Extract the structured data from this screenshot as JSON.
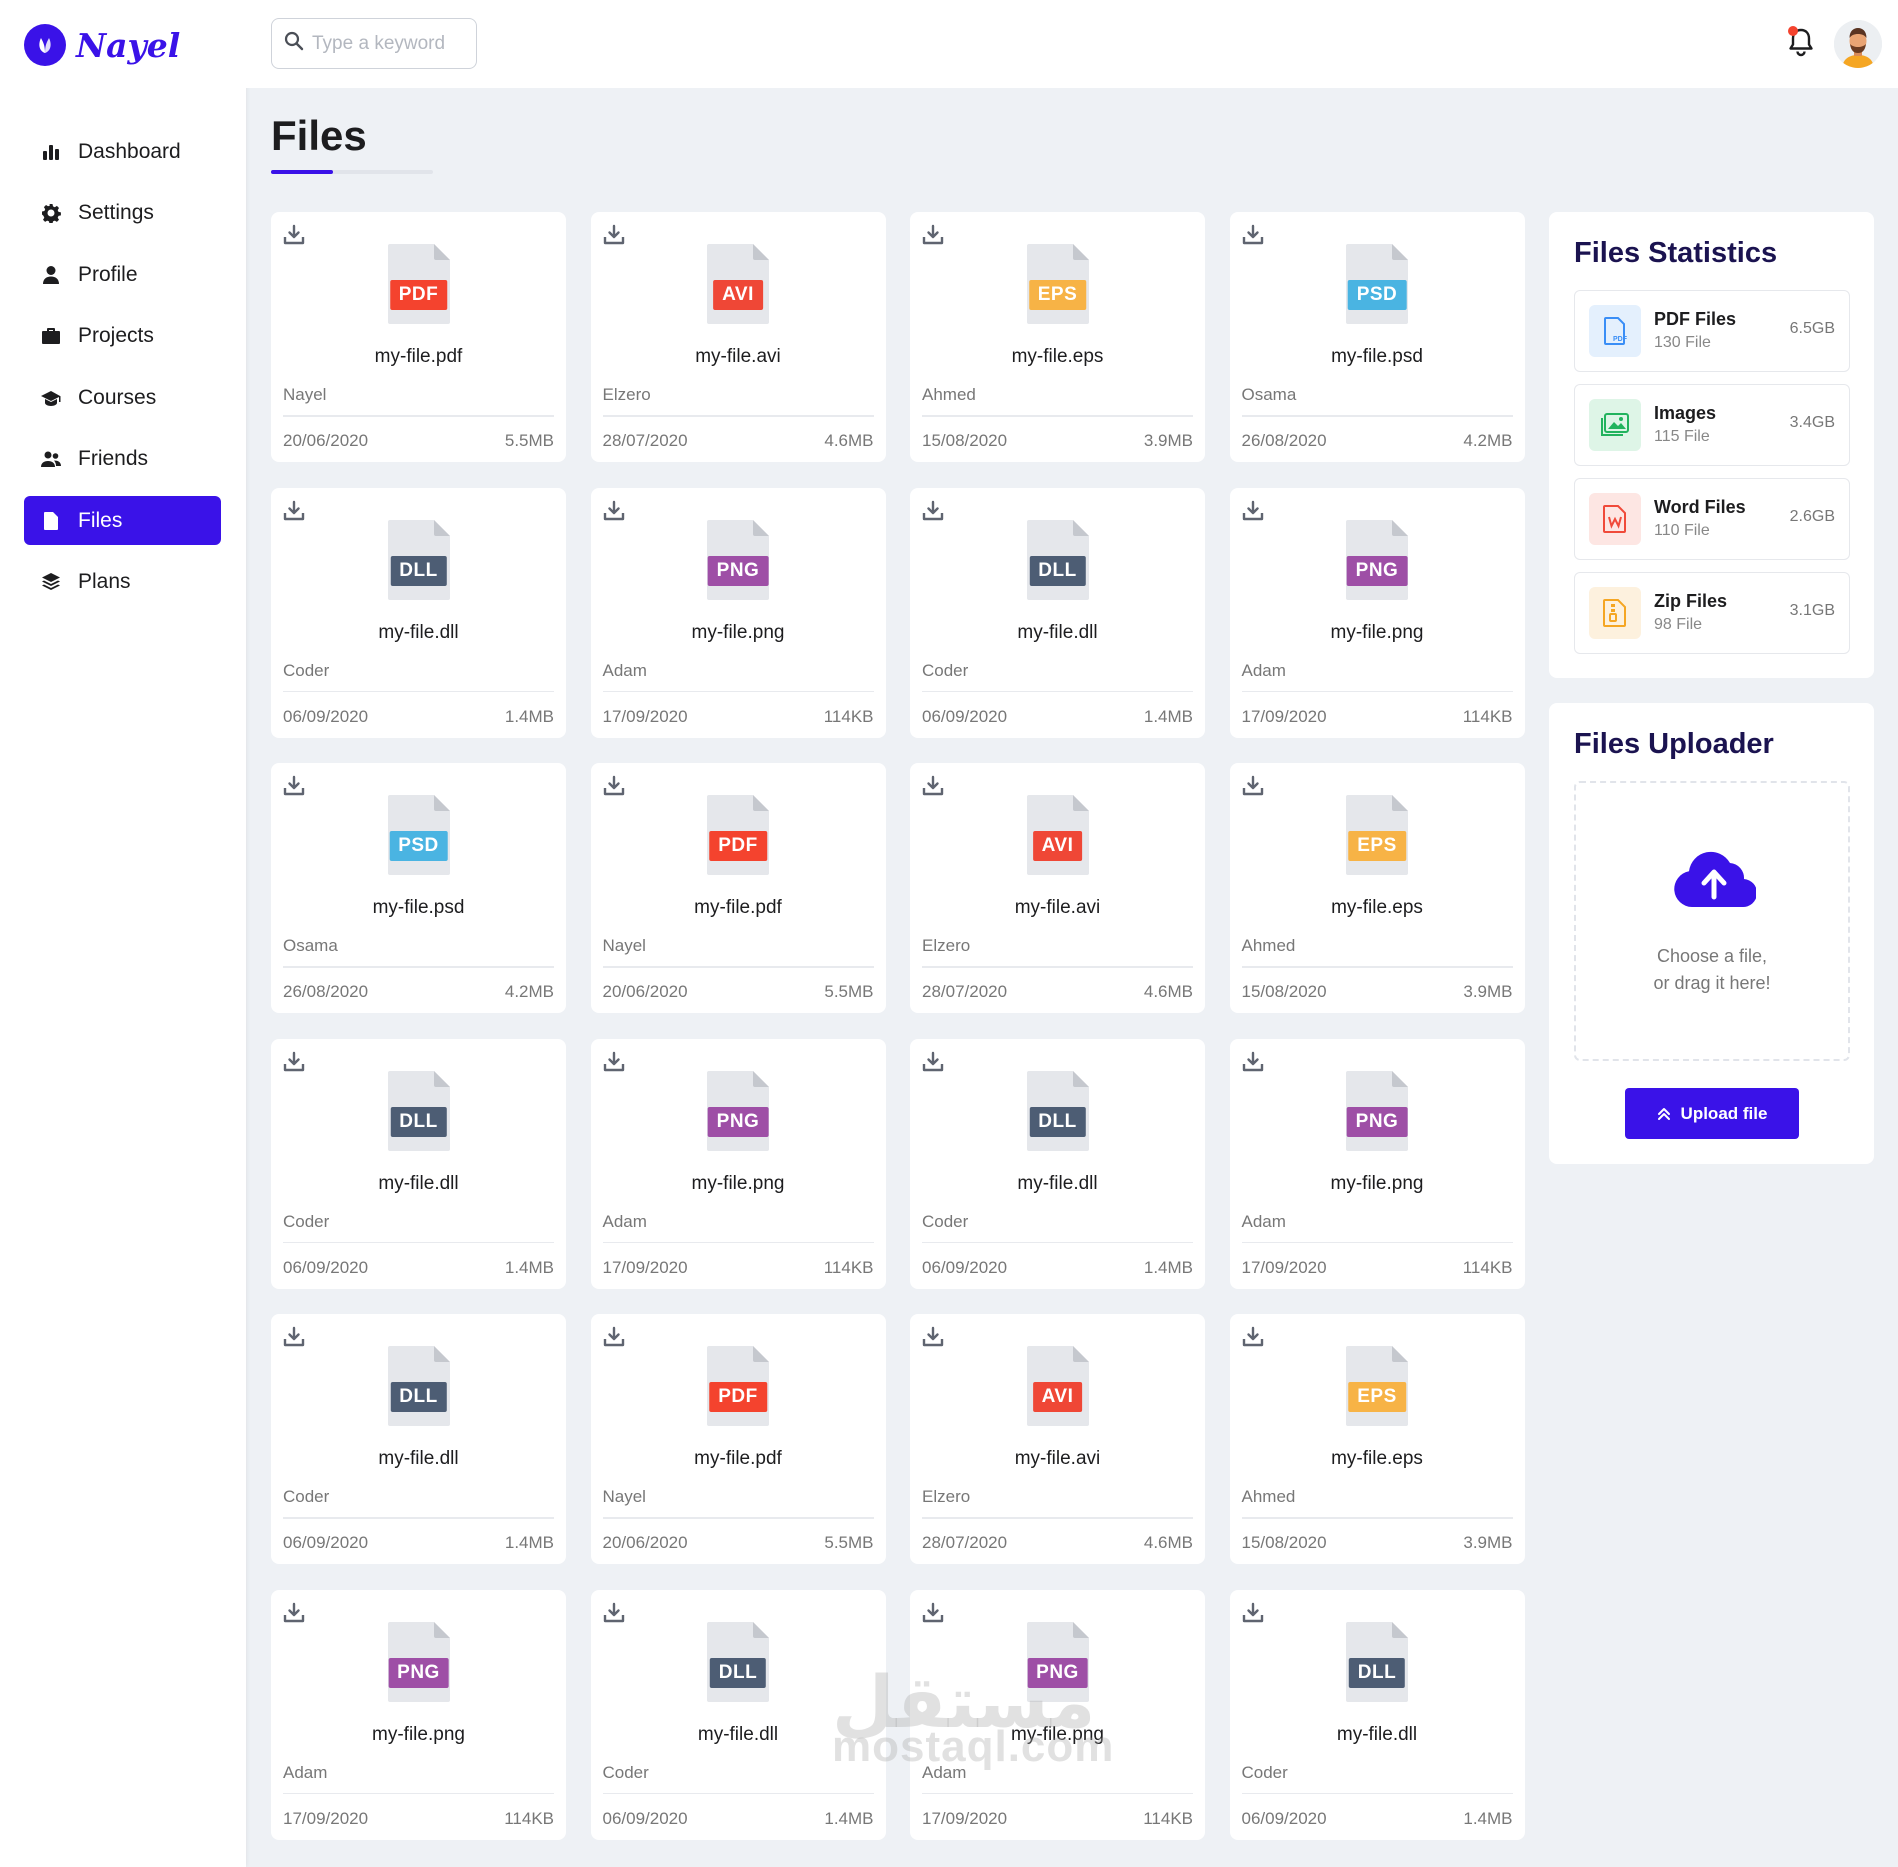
{
  "brand": {
    "name": "Nayel",
    "accent": "#3a12e8"
  },
  "nav": {
    "items": [
      {
        "label": "Dashboard",
        "icon": "bar-chart-icon",
        "active": false
      },
      {
        "label": "Settings",
        "icon": "gear-icon",
        "active": false
      },
      {
        "label": "Profile",
        "icon": "user-icon",
        "active": false
      },
      {
        "label": "Projects",
        "icon": "briefcase-icon",
        "active": false
      },
      {
        "label": "Courses",
        "icon": "graduation-cap-icon",
        "active": false
      },
      {
        "label": "Friends",
        "icon": "users-icon",
        "active": false
      },
      {
        "label": "Files",
        "icon": "file-icon",
        "active": true
      },
      {
        "label": "Plans",
        "icon": "layers-icon",
        "active": false
      }
    ]
  },
  "search": {
    "placeholder": "Type a keyword",
    "value": ""
  },
  "header": {
    "notification_dot_color": "#f4432e"
  },
  "page": {
    "title": "Files"
  },
  "type_colors": {
    "PDF": "#f4432e",
    "AVI": "#ef4736",
    "EPS": "#f7b346",
    "PSD": "#4ab4e2",
    "DLL": "#4d5d74",
    "PNG": "#9e4fa6"
  },
  "files": [
    {
      "type": "PDF",
      "name": "my-file.pdf",
      "owner": "Nayel",
      "date": "20/06/2020",
      "size": "5.5MB"
    },
    {
      "type": "AVI",
      "name": "my-file.avi",
      "owner": "Elzero",
      "date": "28/07/2020",
      "size": "4.6MB"
    },
    {
      "type": "EPS",
      "name": "my-file.eps",
      "owner": "Ahmed",
      "date": "15/08/2020",
      "size": "3.9MB"
    },
    {
      "type": "PSD",
      "name": "my-file.psd",
      "owner": "Osama",
      "date": "26/08/2020",
      "size": "4.2MB"
    },
    {
      "type": "DLL",
      "name": "my-file.dll",
      "owner": "Coder",
      "date": "06/09/2020",
      "size": "1.4MB"
    },
    {
      "type": "PNG",
      "name": "my-file.png",
      "owner": "Adam",
      "date": "17/09/2020",
      "size": "114KB"
    },
    {
      "type": "DLL",
      "name": "my-file.dll",
      "owner": "Coder",
      "date": "06/09/2020",
      "size": "1.4MB"
    },
    {
      "type": "PNG",
      "name": "my-file.png",
      "owner": "Adam",
      "date": "17/09/2020",
      "size": "114KB"
    },
    {
      "type": "PSD",
      "name": "my-file.psd",
      "owner": "Osama",
      "date": "26/08/2020",
      "size": "4.2MB"
    },
    {
      "type": "PDF",
      "name": "my-file.pdf",
      "owner": "Nayel",
      "date": "20/06/2020",
      "size": "5.5MB"
    },
    {
      "type": "AVI",
      "name": "my-file.avi",
      "owner": "Elzero",
      "date": "28/07/2020",
      "size": "4.6MB"
    },
    {
      "type": "EPS",
      "name": "my-file.eps",
      "owner": "Ahmed",
      "date": "15/08/2020",
      "size": "3.9MB"
    },
    {
      "type": "DLL",
      "name": "my-file.dll",
      "owner": "Coder",
      "date": "06/09/2020",
      "size": "1.4MB"
    },
    {
      "type": "PNG",
      "name": "my-file.png",
      "owner": "Adam",
      "date": "17/09/2020",
      "size": "114KB"
    },
    {
      "type": "DLL",
      "name": "my-file.dll",
      "owner": "Coder",
      "date": "06/09/2020",
      "size": "1.4MB"
    },
    {
      "type": "PNG",
      "name": "my-file.png",
      "owner": "Adam",
      "date": "17/09/2020",
      "size": "114KB"
    },
    {
      "type": "DLL",
      "name": "my-file.dll",
      "owner": "Coder",
      "date": "06/09/2020",
      "size": "1.4MB"
    },
    {
      "type": "PDF",
      "name": "my-file.pdf",
      "owner": "Nayel",
      "date": "20/06/2020",
      "size": "5.5MB"
    },
    {
      "type": "AVI",
      "name": "my-file.avi",
      "owner": "Elzero",
      "date": "28/07/2020",
      "size": "4.6MB"
    },
    {
      "type": "EPS",
      "name": "my-file.eps",
      "owner": "Ahmed",
      "date": "15/08/2020",
      "size": "3.9MB"
    },
    {
      "type": "PNG",
      "name": "my-file.png",
      "owner": "Adam",
      "date": "17/09/2020",
      "size": "114KB"
    },
    {
      "type": "DLL",
      "name": "my-file.dll",
      "owner": "Coder",
      "date": "06/09/2020",
      "size": "1.4MB"
    },
    {
      "type": "PNG",
      "name": "my-file.png",
      "owner": "Adam",
      "date": "17/09/2020",
      "size": "114KB"
    },
    {
      "type": "DLL",
      "name": "my-file.dll",
      "owner": "Coder",
      "date": "06/09/2020",
      "size": "1.4MB"
    }
  ],
  "stats": {
    "title": "Files Statistics",
    "items": [
      {
        "name": "PDF Files",
        "count": "130 File",
        "size": "6.5GB",
        "icon": "pdf-file-icon",
        "color": "#3a8ef6",
        "bg": "#e4f0fd"
      },
      {
        "name": "Images",
        "count": "115 File",
        "size": "3.4GB",
        "icon": "image-icon",
        "color": "#22b35e",
        "bg": "#def5e7"
      },
      {
        "name": "Word Files",
        "count": "110 File",
        "size": "2.6GB",
        "icon": "word-file-icon",
        "color": "#f04a3a",
        "bg": "#fde6e3"
      },
      {
        "name": "Zip Files",
        "count": "98 File",
        "size": "3.1GB",
        "icon": "zip-file-icon",
        "color": "#f5a623",
        "bg": "#fdf1de"
      }
    ]
  },
  "uploader": {
    "title": "Files Uploader",
    "drop_line1": "Choose a file,",
    "drop_line2": "or drag it here!",
    "button_label": "Upload file"
  },
  "watermark": {
    "arabic": "مستقل",
    "latin": "mostaql.com"
  }
}
